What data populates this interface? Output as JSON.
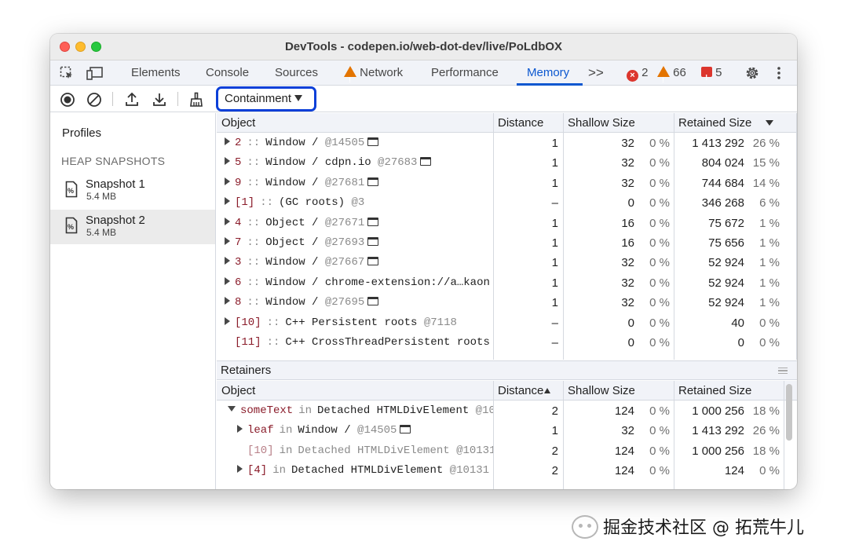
{
  "window": {
    "title": "DevTools - codepen.io/web-dot-dev/live/PoLdbOX"
  },
  "tabs": [
    {
      "label": "Elements"
    },
    {
      "label": "Console"
    },
    {
      "label": "Sources"
    },
    {
      "label": "Network"
    },
    {
      "label": "Performance"
    },
    {
      "label": "Memory",
      "active": true
    }
  ],
  "status": {
    "errors": "2",
    "warnings": "66",
    "issues": "5",
    "more": ">>"
  },
  "toolbar": {
    "view_select": "Containment"
  },
  "sidebar": {
    "profiles_label": "Profiles",
    "section_heading": "HEAP SNAPSHOTS",
    "snapshots": [
      {
        "name": "Snapshot 1",
        "size": "5.4 MB",
        "selected": false
      },
      {
        "name": "Snapshot 2",
        "size": "5.4 MB",
        "selected": true
      }
    ]
  },
  "columns": {
    "object": "Object",
    "distance": "Distance",
    "shallow": "Shallow Size",
    "retained": "Retained Size"
  },
  "objects": [
    {
      "key": "2",
      "sep": "::",
      "name": "Window /  ",
      "id": "@14505",
      "win": true,
      "distance": "1",
      "shallow": "32",
      "shallow_pct": "0 %",
      "retained": "1 413 292",
      "retained_pct": "26 %",
      "expandable": true
    },
    {
      "key": "5",
      "sep": "::",
      "name": "Window / cdpn.io ",
      "id": "@27683",
      "win": true,
      "distance": "1",
      "shallow": "32",
      "shallow_pct": "0 %",
      "retained": "804 024",
      "retained_pct": "15 %",
      "expandable": true
    },
    {
      "key": "9",
      "sep": "::",
      "name": "Window /  ",
      "id": "@27681",
      "win": true,
      "distance": "1",
      "shallow": "32",
      "shallow_pct": "0 %",
      "retained": "744 684",
      "retained_pct": "14 %",
      "expandable": true
    },
    {
      "key": "[1]",
      "sep": "::",
      "name": "(GC roots) ",
      "id": "@3",
      "win": false,
      "distance": "–",
      "shallow": "0",
      "shallow_pct": "0 %",
      "retained": "346 268",
      "retained_pct": "6 %",
      "expandable": true
    },
    {
      "key": "4",
      "sep": "::",
      "name": "Object /  ",
      "id": "@27671",
      "win": true,
      "distance": "1",
      "shallow": "16",
      "shallow_pct": "0 %",
      "retained": "75 672",
      "retained_pct": "1 %",
      "expandable": true
    },
    {
      "key": "7",
      "sep": "::",
      "name": "Object /  ",
      "id": "@27693",
      "win": true,
      "distance": "1",
      "shallow": "16",
      "shallow_pct": "0 %",
      "retained": "75 656",
      "retained_pct": "1 %",
      "expandable": true
    },
    {
      "key": "3",
      "sep": "::",
      "name": "Window /  ",
      "id": "@27667",
      "win": true,
      "distance": "1",
      "shallow": "32",
      "shallow_pct": "0 %",
      "retained": "52 924",
      "retained_pct": "1 %",
      "expandable": true
    },
    {
      "key": "6",
      "sep": "::",
      "name": "Window / chrome-extension://a…kaon",
      "id": "",
      "win": false,
      "distance": "1",
      "shallow": "32",
      "shallow_pct": "0 %",
      "retained": "52 924",
      "retained_pct": "1 %",
      "expandable": true
    },
    {
      "key": "8",
      "sep": "::",
      "name": "Window /  ",
      "id": "@27695",
      "win": true,
      "distance": "1",
      "shallow": "32",
      "shallow_pct": "0 %",
      "retained": "52 924",
      "retained_pct": "1 %",
      "expandable": true
    },
    {
      "key": "[10]",
      "sep": "::",
      "name": "C++ Persistent roots ",
      "id": "@7118",
      "win": false,
      "distance": "–",
      "shallow": "0",
      "shallow_pct": "0 %",
      "retained": "40",
      "retained_pct": "0 %",
      "expandable": true
    },
    {
      "key": "[11]",
      "sep": "::",
      "name": "C++ CrossThreadPersistent roots",
      "id": "",
      "win": false,
      "distance": "–",
      "shallow": "0",
      "shallow_pct": "0 %",
      "retained": "0",
      "retained_pct": "0 %",
      "expandable": false
    }
  ],
  "retainers": {
    "label": "Retainers",
    "rows": [
      {
        "key": "someText",
        "prep": "in",
        "name": "Detached HTMLDivElement ",
        "id": "@10",
        "win": false,
        "distance": "2",
        "shallow": "124",
        "shallow_pct": "0 %",
        "retained": "1 000 256",
        "retained_pct": "18 %",
        "indent": 0,
        "arrow": "down",
        "dim": false
      },
      {
        "key": "leaf",
        "prep": "in",
        "name": "Window /  ",
        "id": "@14505",
        "win": true,
        "distance": "1",
        "shallow": "32",
        "shallow_pct": "0 %",
        "retained": "1 413 292",
        "retained_pct": "26 %",
        "indent": 1,
        "arrow": "right",
        "dim": false
      },
      {
        "key": "[10]",
        "prep": "in",
        "name": "Detached HTMLDivElement ",
        "id": "@10131",
        "win": false,
        "distance": "2",
        "shallow": "124",
        "shallow_pct": "0 %",
        "retained": "1 000 256",
        "retained_pct": "18 %",
        "indent": 1,
        "arrow": "none",
        "dim": true
      },
      {
        "key": "[4]",
        "prep": "in",
        "name": "Detached HTMLDivElement ",
        "id": "@10131",
        "win": false,
        "distance": "2",
        "shallow": "124",
        "shallow_pct": "0 %",
        "retained": "124",
        "retained_pct": "0 %",
        "indent": 1,
        "arrow": "right",
        "dim": false
      }
    ]
  },
  "watermark": "掘金技术社区 @ 拓荒牛儿"
}
